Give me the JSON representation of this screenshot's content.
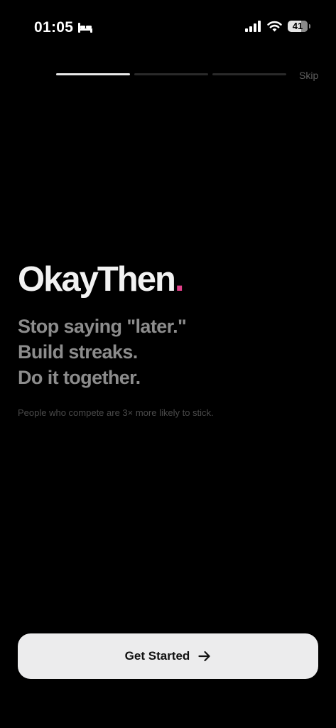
{
  "status_bar": {
    "time": "01:05",
    "battery": "41",
    "icons": [
      "bed-icon",
      "signal-icon",
      "wifi-icon",
      "battery-icon"
    ]
  },
  "onboarding": {
    "skip_label": "Skip",
    "progress": {
      "current_step": 1,
      "total_steps": 3
    }
  },
  "hero": {
    "brand_name": "OkayThen",
    "brand_dot": ".",
    "taglines": [
      "Stop saying \"later.\"",
      "Build streaks.",
      "Do it together."
    ],
    "stat_note": "People who compete are 3× more likely to stick."
  },
  "cta": {
    "label": "Get Started",
    "icon": "arrow-right-icon"
  },
  "colors": {
    "background": "#000000",
    "accent": "#e0408a",
    "tagline": "#8c8c8c",
    "button_bg": "#ececed"
  }
}
